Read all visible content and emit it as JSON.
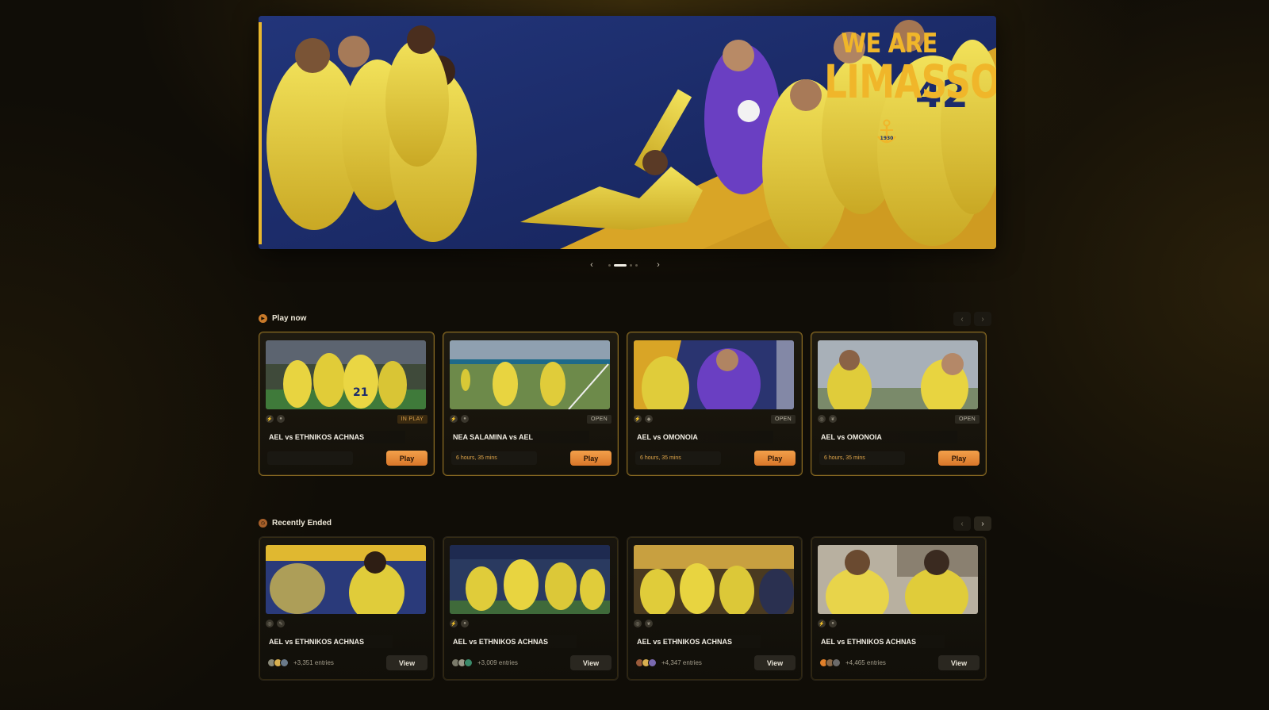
{
  "hero": {
    "headline_line1": "We are",
    "headline_line2": "Limassol",
    "badge_year": "1930",
    "nav": {
      "prev": "‹",
      "next": "›",
      "dot_count": 4,
      "active_dot": 1
    }
  },
  "play_now": {
    "title": "Play now",
    "icon": "play-icon",
    "arrows": {
      "prev": "‹",
      "next": "›"
    },
    "cards": [
      {
        "match": "AEL vs ETHNIKOS ACHNAS",
        "status": "IN PLAY",
        "time": "",
        "button": "Play"
      },
      {
        "match": "NEA SALAMINA vs AEL",
        "status": "OPEN",
        "time": "6 hours, 35 mins",
        "button": "Play"
      },
      {
        "match": "AEL vs OMONOIA",
        "status": "OPEN",
        "time": "6 hours, 35 mins",
        "button": "Play"
      },
      {
        "match": "AEL vs OMONOIA",
        "status": "OPEN",
        "time": "6 hours, 35 mins",
        "button": "Play"
      }
    ]
  },
  "recently_ended": {
    "title": "Recently Ended",
    "icon": "clock-icon",
    "arrows": {
      "prev": "‹",
      "next": "›"
    },
    "cards": [
      {
        "match": "AEL vs ETHNIKOS ACHNAS",
        "entries": "+3,351 entries",
        "button": "View"
      },
      {
        "match": "AEL vs ETHNIKOS ACHNAS",
        "entries": "+3,009 entries",
        "button": "View"
      },
      {
        "match": "AEL vs ETHNIKOS ACHNAS",
        "entries": "+4,347 entries",
        "button": "View"
      },
      {
        "match": "AEL vs ETHNIKOS ACHNAS",
        "entries": "+4,465 entries",
        "button": "View"
      }
    ]
  },
  "colors": {
    "accent": "#e8b72e",
    "navy": "#1b2b6b",
    "play_button": "#e88a3a",
    "background": "#100d07"
  }
}
